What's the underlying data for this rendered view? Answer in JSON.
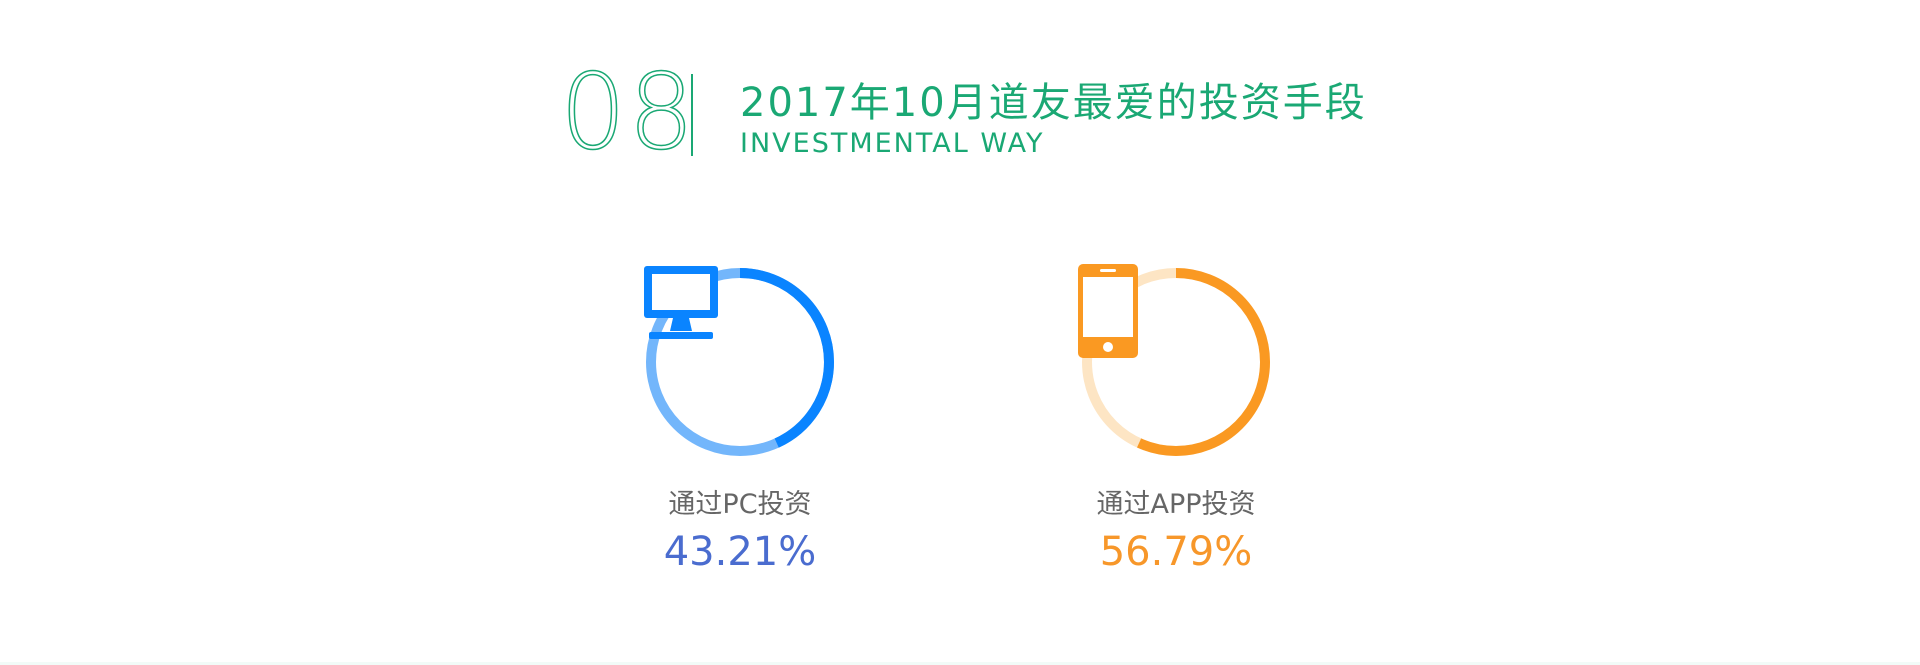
{
  "header": {
    "number": "08",
    "title": "2017年10月道友最爱的投资手段",
    "subtitle": "INVESTMENTAL WAY"
  },
  "chart_data": {
    "type": "pie",
    "series": [
      {
        "label": "通过PC投资",
        "value": 43.21,
        "value_text": "43.21%",
        "icon": "desktop-monitor-icon",
        "color": "#0a84ff",
        "track_color": "#73b6fb",
        "value_color": "#4a6ccf"
      },
      {
        "label": "通过APP投资",
        "value": 56.79,
        "value_text": "56.79%",
        "icon": "smartphone-icon",
        "color": "#fa9922",
        "track_color": "#fde5c4",
        "value_color": "#f7972a"
      }
    ]
  }
}
